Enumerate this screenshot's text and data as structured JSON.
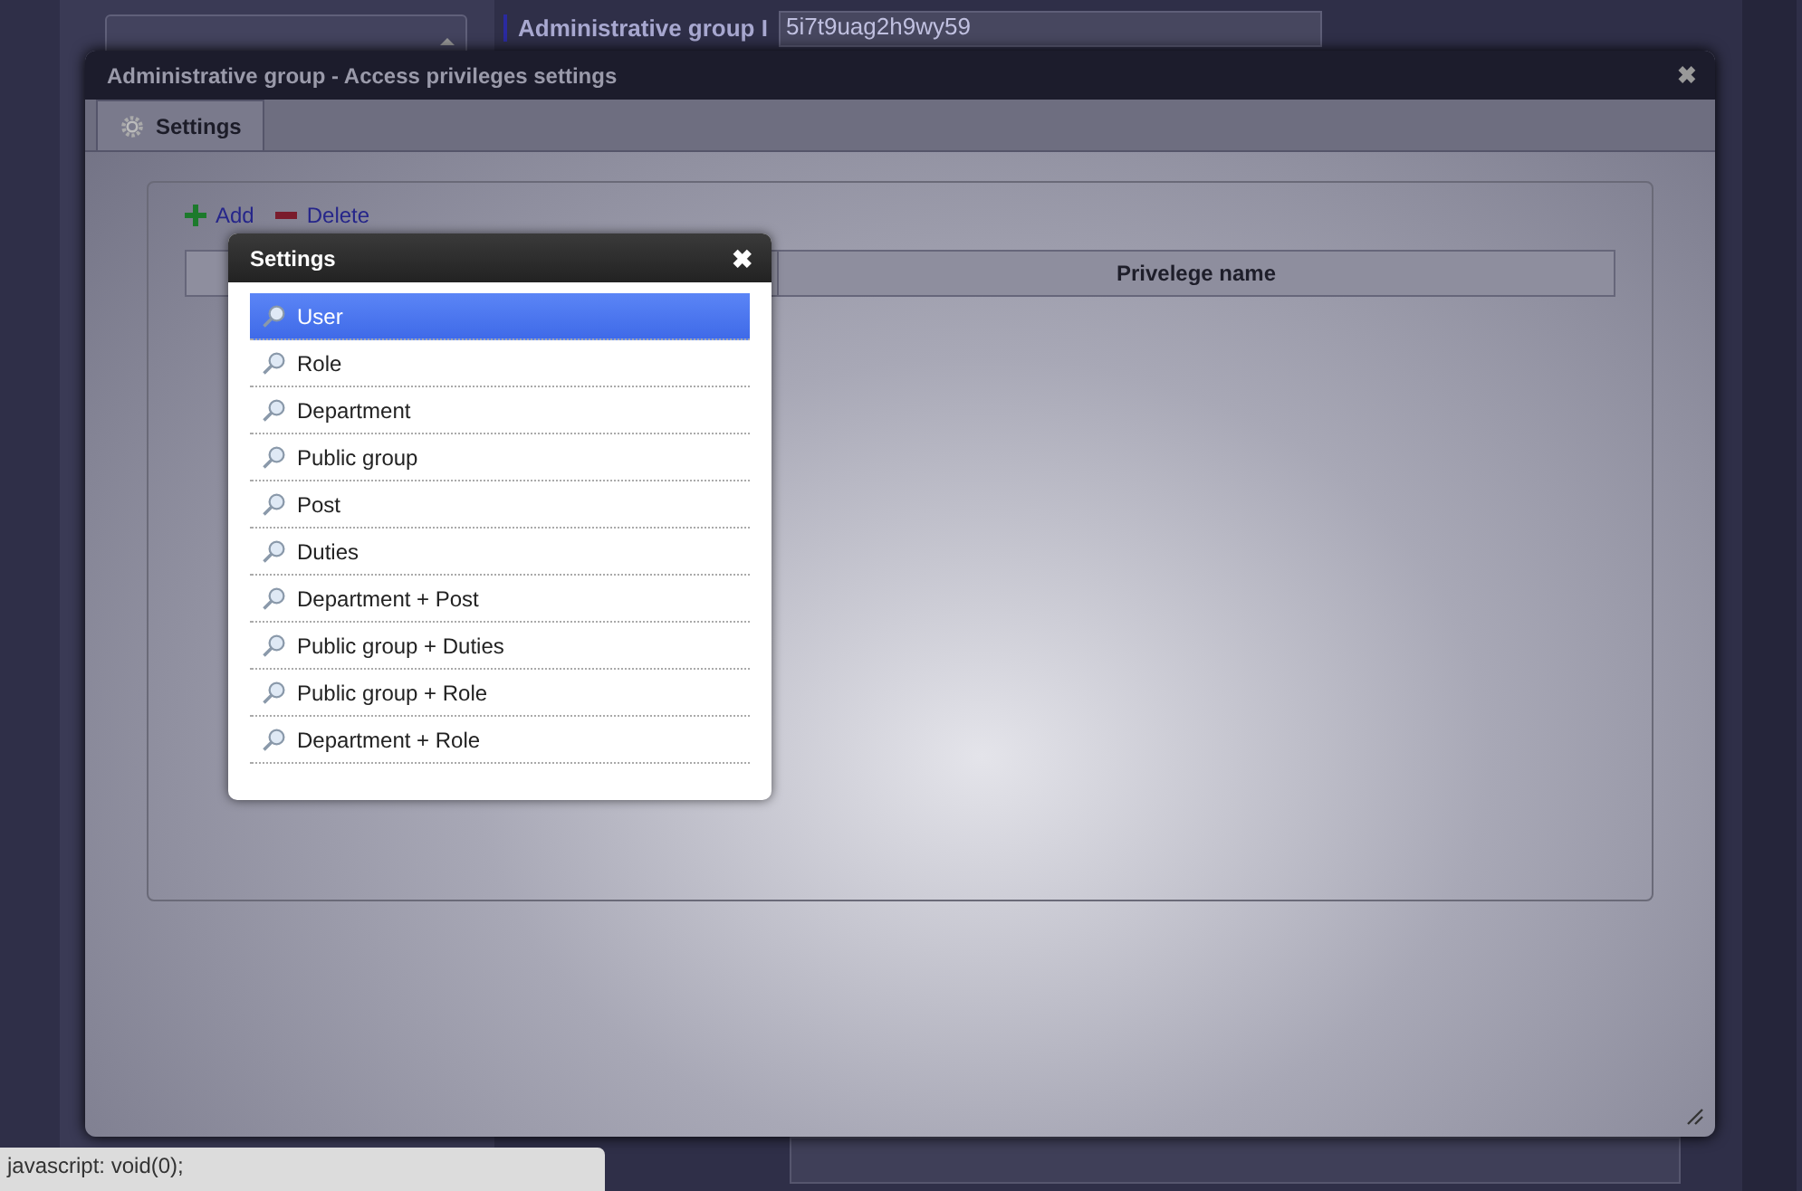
{
  "background": {
    "label": "Administrative group I",
    "value": "5i7t9uag2h9wy59"
  },
  "dialog": {
    "title": "Administrative group - Access privileges settings",
    "close": "✖",
    "tabs": [
      {
        "label": "Settings",
        "selected": true
      }
    ],
    "toolbar": [
      "Add",
      "Delete"
    ],
    "table": {
      "columns": [
        "",
        "Privelege name"
      ]
    }
  },
  "popup": {
    "title": "Settings",
    "close": "✖",
    "items": [
      {
        "label": "User",
        "selected": true
      },
      {
        "label": "Role",
        "selected": false
      },
      {
        "label": "Department",
        "selected": false
      },
      {
        "label": "Public group",
        "selected": false
      },
      {
        "label": "Post",
        "selected": false
      },
      {
        "label": "Duties",
        "selected": false
      },
      {
        "label": "Department + Post",
        "selected": false
      },
      {
        "label": "Public group + Duties",
        "selected": false
      },
      {
        "label": "Public group + Role",
        "selected": false
      },
      {
        "label": "Department + Role",
        "selected": false
      }
    ]
  },
  "status_bar": "javascript: void(0);"
}
